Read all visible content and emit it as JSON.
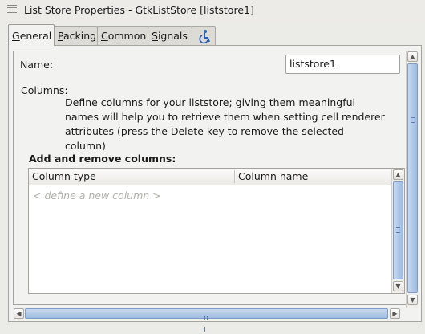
{
  "window": {
    "title": "List Store Properties - GtkListStore [liststore1]"
  },
  "tabs": [
    {
      "label_first": "G",
      "label_rest": "eneral",
      "active": true
    },
    {
      "label_first": "P",
      "label_rest": "acking",
      "active": false
    },
    {
      "label_first": "C",
      "label_rest": "ommon",
      "active": false
    },
    {
      "label_first": "S",
      "label_rest": "ignals",
      "active": false
    },
    {
      "icon": "accessibility-icon",
      "active": false
    }
  ],
  "general": {
    "name_label": "Name:",
    "name_value": "liststore1",
    "columns_label": "Columns:",
    "description": "Define columns for your liststore; giving them meaningful names will help you to retrieve them when setting cell renderer attributes (press the Delete key to remove the selected column)",
    "section_title": "Add and remove columns:",
    "table": {
      "headers": [
        "Column type",
        "Column name"
      ],
      "placeholder_row": "< define a new column >"
    }
  },
  "colors": {
    "scroll_thumb": "#9fbbe0",
    "accessibility_icon": "#2a5db0"
  }
}
